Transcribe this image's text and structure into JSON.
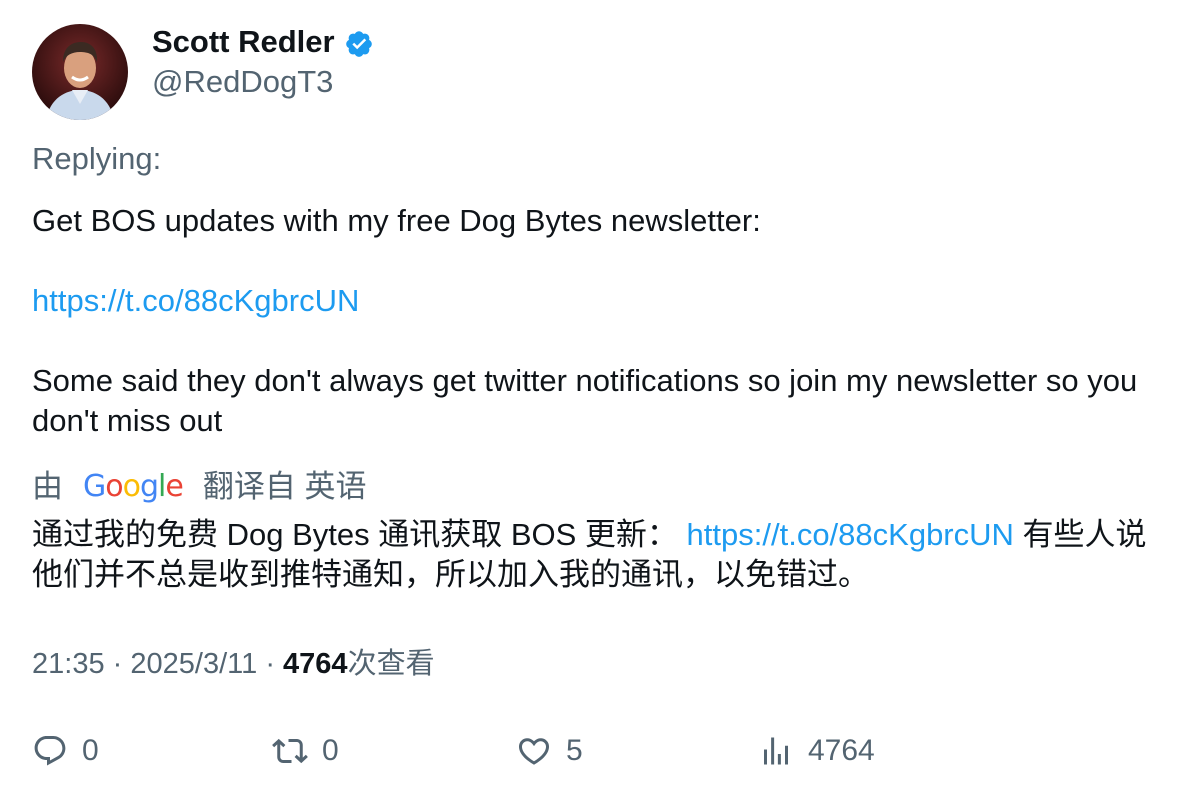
{
  "author": {
    "display_name": "Scott Redler",
    "handle": "@RedDogT3",
    "verified": true,
    "avatar_icon": "profile-photo"
  },
  "replying_label": "Replying:",
  "tweet": {
    "line1": "Get BOS updates with my free Dog Bytes newsletter:",
    "link": "https://t.co/88cKgbrcUN",
    "line2": "Some said they don't always get twitter notifications so join my newsletter so you don't miss out"
  },
  "translation": {
    "by_label": "由",
    "provider": "Google",
    "from_label": "翻译自 英语",
    "text_before_link": "通过我的免费 Dog Bytes 通讯获取 BOS 更新： ",
    "link": "https://t.co/88cKgbrcUN",
    "text_after_link": " 有些人说他们并不总是收到推特通知，所以加入我的通讯，以免错过。"
  },
  "meta": {
    "time": "21:35",
    "separator": "·",
    "date": "2025/3/11",
    "views_count": "4764",
    "views_label": "次查看"
  },
  "actions": {
    "replies": "0",
    "retweets": "0",
    "likes": "5",
    "views": "4764"
  },
  "colors": {
    "link": "#1d9bf0",
    "secondary_text": "#536471",
    "verified_badge": "#1d9bf0"
  }
}
